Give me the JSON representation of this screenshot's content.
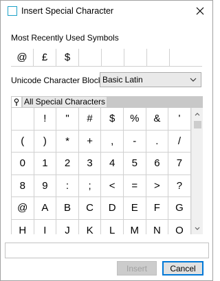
{
  "window": {
    "title": "Insert Special Character"
  },
  "mru": {
    "label": "Most Recently Used Symbols",
    "symbols": [
      "@",
      "£",
      "$",
      "",
      "",
      "",
      "",
      ""
    ]
  },
  "block": {
    "label": "Unicode Character Block:",
    "selected": "Basic Latin"
  },
  "grid": {
    "header": "All Special Characters",
    "rows": [
      [
        " ",
        "!",
        "\"",
        "#",
        "$",
        "%",
        "&",
        "'"
      ],
      [
        "(",
        ")",
        "*",
        "+",
        ",",
        "-",
        ".",
        "/"
      ],
      [
        "0",
        "1",
        "2",
        "3",
        "4",
        "5",
        "6",
        "7"
      ],
      [
        "8",
        "9",
        ":",
        ";",
        "<",
        "=",
        ">",
        "?"
      ],
      [
        "@",
        "A",
        "B",
        "C",
        "D",
        "E",
        "F",
        "G"
      ],
      [
        "H",
        "I",
        "J",
        "K",
        "L",
        "M",
        "N",
        "O"
      ]
    ]
  },
  "input": {
    "value": ""
  },
  "buttons": {
    "insert": "Insert",
    "cancel": "Cancel"
  },
  "icons": {
    "close": "close-icon",
    "dropdown": "chevron-down-icon",
    "pin": "pin-icon",
    "scroll_up": "chevron-up-icon",
    "scroll_down": "chevron-down-icon"
  },
  "colors": {
    "title_icon": "#1ba1c7",
    "default_button_border": "#0078d7",
    "grid_header": "#c8c8c8"
  }
}
